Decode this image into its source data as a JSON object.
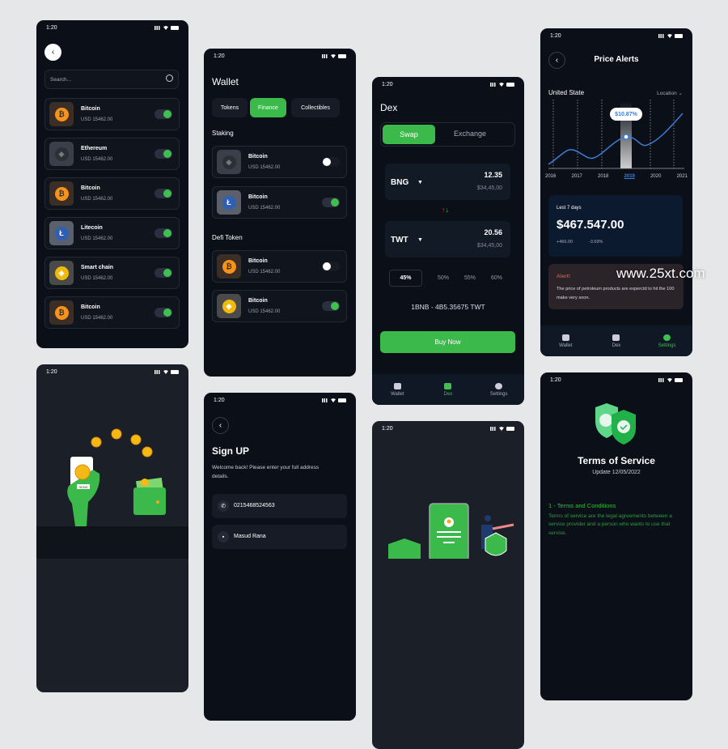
{
  "status_time": "1:20",
  "accent": "#3cb94b",
  "screen_coins": {
    "search_placeholder": "Search...",
    "items": [
      {
        "name": "Bitcoin",
        "value": "USD 15462.00",
        "icon": "bitcoin-icon",
        "on": true
      },
      {
        "name": "Ethereum",
        "value": "USD 15462.00",
        "icon": "ethereum-icon",
        "on": true
      },
      {
        "name": "Bitcoin",
        "value": "USD 15462.00",
        "icon": "bitcoin-icon",
        "on": true
      },
      {
        "name": "Litecoin",
        "value": "USD 15462.00",
        "icon": "litecoin-icon",
        "on": true
      },
      {
        "name": "Smart chain",
        "value": "USD 15462.00",
        "icon": "bnb-icon",
        "on": true
      },
      {
        "name": "Bitcoin",
        "value": "USD 15462.00",
        "icon": "bitcoin-icon",
        "on": true
      }
    ]
  },
  "screen_wallet": {
    "title": "Wallet",
    "tabs": [
      {
        "label": "Tokens"
      },
      {
        "label": "Finance",
        "active": true
      },
      {
        "label": "Collectibles"
      }
    ],
    "staking_label": "Staking",
    "staking": [
      {
        "name": "Bitcoin",
        "value": "USD 15462.00",
        "icon": "ethereum-icon",
        "on": false
      },
      {
        "name": "Bitcoin",
        "value": "USD 15462.00",
        "icon": "litecoin-icon",
        "on": true
      }
    ],
    "defi_label": "Defi Token",
    "defi": [
      {
        "name": "Bitcoin",
        "value": "USD 15462.00",
        "icon": "bitcoin-icon",
        "on": false
      },
      {
        "name": "Bitcoin",
        "value": "USD 15462.00",
        "icon": "bnb-icon",
        "on": true
      }
    ]
  },
  "screen_dex": {
    "title": "Dex",
    "segments": [
      "Swap",
      "Exchange"
    ],
    "from": {
      "token": "BNG",
      "amount": "12.35",
      "usd": "$34,45,00"
    },
    "to": {
      "token": "TWT",
      "amount": "20.56",
      "usd": "$34,45,00"
    },
    "percents": [
      "45%",
      "50%",
      "55%",
      "60%"
    ],
    "selected_percent": "45%",
    "rate": "1BNB - 4B5.35675 TWT",
    "buy_label": "Buy Now",
    "nav": [
      {
        "label": "Wallet"
      },
      {
        "label": "Dex",
        "active": true
      },
      {
        "label": "Settings"
      }
    ]
  },
  "screen_alerts": {
    "title": "Price Alerts",
    "region": "United State",
    "location_label": "Location",
    "years": [
      "2016",
      "2017",
      "2018",
      "2019",
      "2020",
      "2021"
    ],
    "selected_year": "2019",
    "tooltip": "$10.87%",
    "card_label": "Lest 7 days",
    "card_value": "$467.547.00",
    "change_abs": "+466.00",
    "change_pct": "-3.69%",
    "alert_title": "Alert!",
    "alert_text": "The price of petroleum products are experctd to hit the 100 make very soon.",
    "nav": [
      {
        "label": "Wallet"
      },
      {
        "label": "Dex"
      },
      {
        "label": "Settings",
        "active": true
      }
    ]
  },
  "screen_send": {
    "send_label": "SEND"
  },
  "screen_signup": {
    "title": "Sign UP",
    "subtitle": "Welcome back! Please enter your full address details.",
    "phone_value": "0215468524563",
    "name_value": "Masud Rana"
  },
  "screen_terms": {
    "title": "Terms of Service",
    "updated": "Update 12/05/2022",
    "section_title": "1 - Terms and Conditions",
    "section_text": "Terms of service are the legal agreements between a service provider and a person who wants to use that service."
  },
  "watermark": "www.25xt.com"
}
